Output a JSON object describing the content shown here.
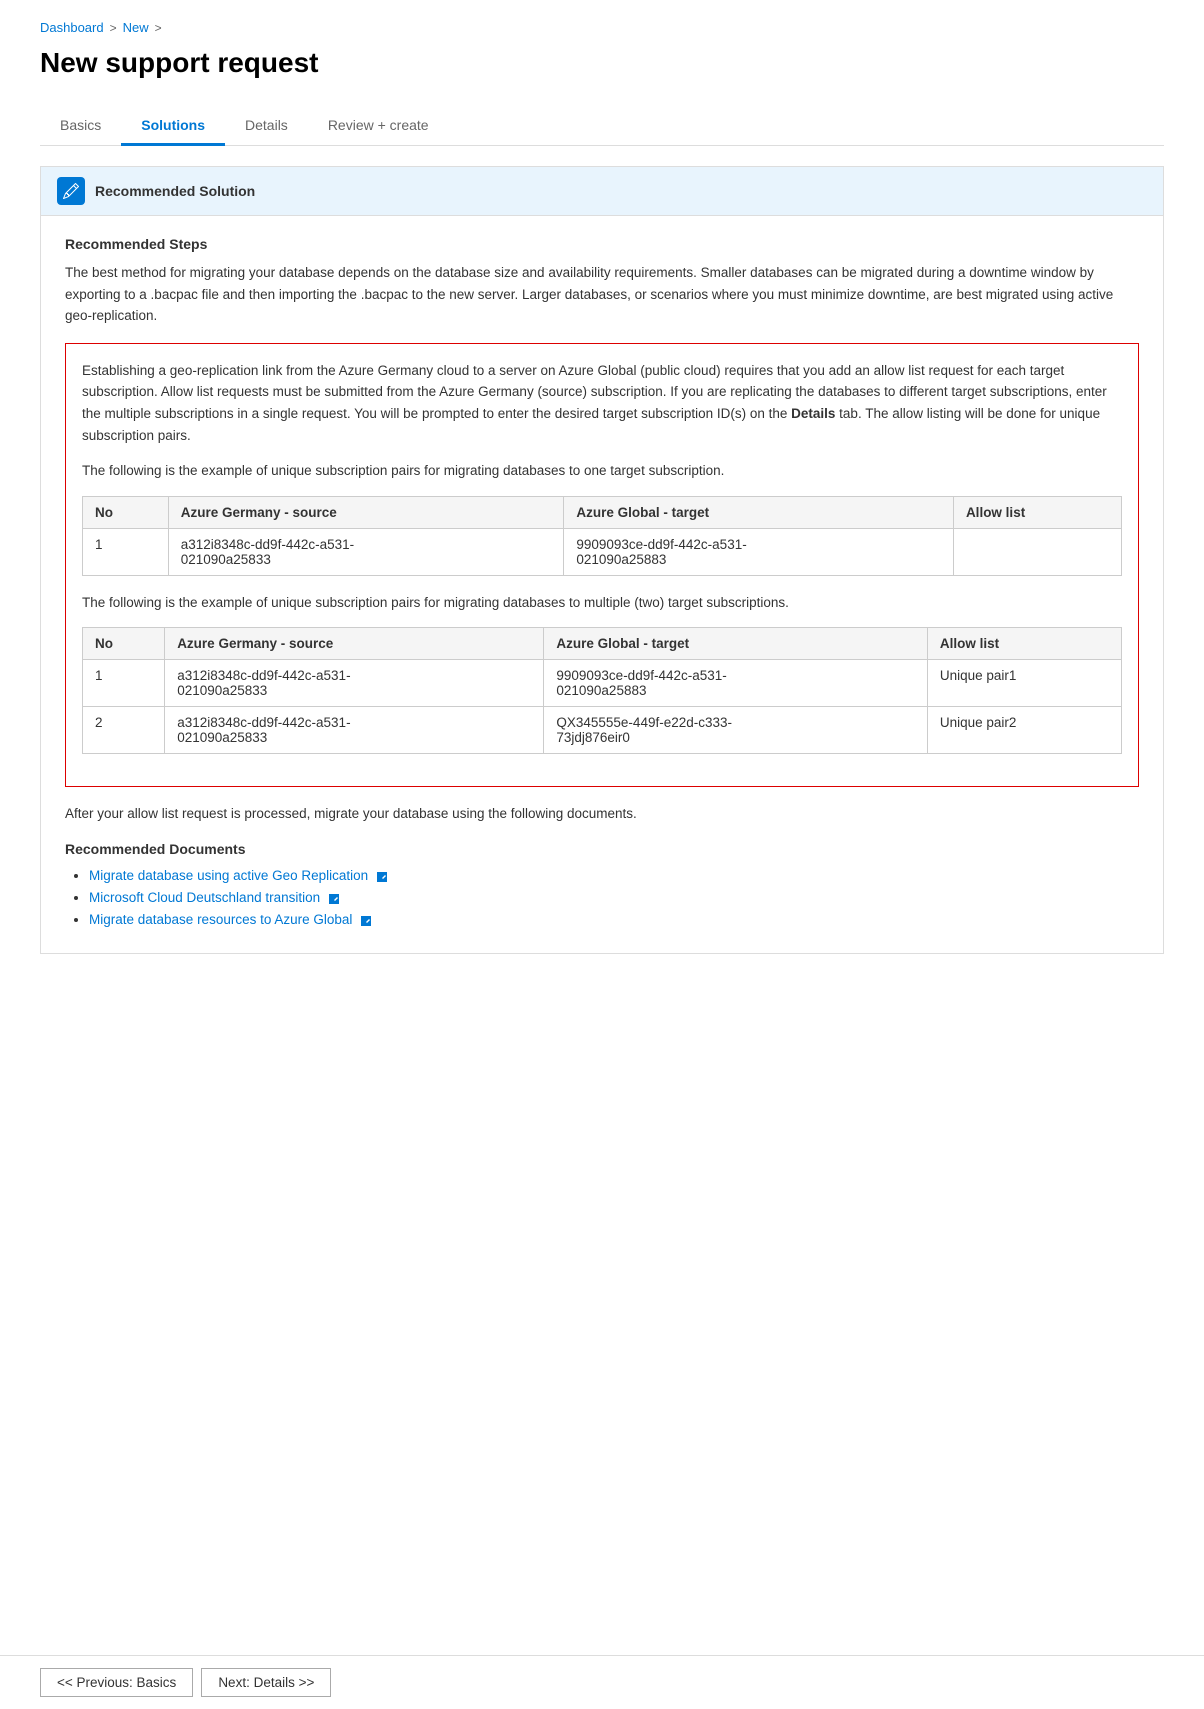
{
  "breadcrumb": {
    "items": [
      "Dashboard",
      "New"
    ],
    "separators": [
      ">",
      ">"
    ]
  },
  "page_title": "New support request",
  "tabs": [
    {
      "id": "basics",
      "label": "Basics",
      "active": false
    },
    {
      "id": "solutions",
      "label": "Solutions",
      "active": true
    },
    {
      "id": "details",
      "label": "Details",
      "active": false
    },
    {
      "id": "review_create",
      "label": "Review + create",
      "active": false
    }
  ],
  "rec_solution": {
    "header": "Recommended Solution",
    "steps_title": "Recommended Steps",
    "intro_text": "The best method for migrating your database depends on the database size and availability requirements. Smaller databases can be migrated during a downtime window by exporting to a .bacpac file and then importing the .bacpac to the new server. Larger databases, or scenarios where you must minimize downtime, are best migrated using active geo-replication.",
    "red_section": {
      "para1": "Establishing a geo-replication link from the Azure Germany cloud to a server on Azure Global (public cloud) requires that you add an allow list request for each target subscription. Allow list requests must be submitted from the Azure Germany (source) subscription. If you are replicating the databases to different target subscriptions, enter the multiple subscriptions in a single request. You will be prompted to enter the desired target subscription ID(s) on the Details tab. The allow listing will be done for unique subscription pairs.",
      "para1_bold_word": "Details",
      "table1_intro": "The following is the example of unique subscription pairs for migrating databases to one target subscription.",
      "table1": {
        "headers": [
          "No",
          "Azure Germany - source",
          "Azure Global - target",
          "Allow list"
        ],
        "rows": [
          {
            "no": "1",
            "source": "a312i8348c-dd9f-442c-a531-\n021090a25833",
            "target": "9909093ce-dd9f-442c-a531-\n021090a25883",
            "allow": ""
          }
        ]
      },
      "table2_intro": "The following is the example of unique subscription pairs for migrating databases to multiple (two) target subscriptions.",
      "table2": {
        "headers": [
          "No",
          "Azure Germany - source",
          "Azure Global - target",
          "Allow list"
        ],
        "rows": [
          {
            "no": "1",
            "source": "a312i8348c-dd9f-442c-a531-\n021090a25833",
            "target": "9909093ce-dd9f-442c-a531-\n021090a25883",
            "allow": "Unique pair1"
          },
          {
            "no": "2",
            "source": "a312i8348c-dd9f-442c-a531-\n021090a25833",
            "target": "QX345555e-449f-e22d-c333-\n73jdj876eir0",
            "allow": "Unique pair2"
          }
        ]
      }
    },
    "after_text": "After your allow list request is processed, migrate your database using the following documents.",
    "docs_title": "Recommended Documents",
    "docs": [
      {
        "label": "Migrate database using active Geo Replication",
        "url": "#"
      },
      {
        "label": "Microsoft Cloud Deutschland transition",
        "url": "#"
      },
      {
        "label": "Migrate database resources to Azure Global",
        "url": "#"
      }
    ]
  },
  "buttons": {
    "prev": "<< Previous: Basics",
    "next": "Next: Details >>"
  }
}
